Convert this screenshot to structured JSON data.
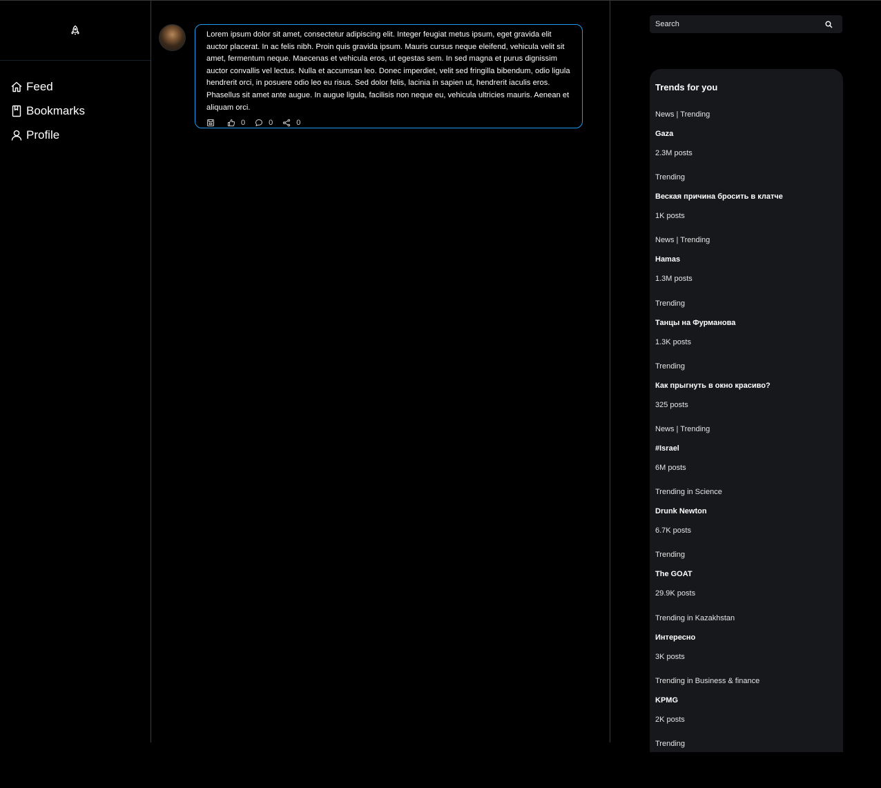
{
  "sidebar": {
    "items": [
      {
        "label": "Feed",
        "icon": "home-icon"
      },
      {
        "label": "Bookmarks",
        "icon": "bookmark-icon"
      },
      {
        "label": "Profile",
        "icon": "user-icon"
      }
    ]
  },
  "post": {
    "text": "Lorem ipsum dolor sit amet, consectetur adipiscing elit. Integer feugiat metus ipsum, eget gravida elit auctor placerat. In ac felis nibh. Proin quis gravida ipsum. Mauris cursus neque eleifend, vehicula velit sit amet, fermentum neque. Maecenas et vehicula eros, ut egestas sem. In sed magna et purus dignissim auctor convallis vel lectus. Nulla et accumsan leo. Donec imperdiet, velit sed fringilla bibendum, odio ligula hendrerit orci, in posuere odio leo eu risus. Sed dolor felis, lacinia in sapien ut, hendrerit iaculis eros. Phasellus sit amet ante augue. In augue ligula, facilisis non neque eu, vehicula ultricies mauris. Aenean et aliquam orci.",
    "likes": "0",
    "comments": "0",
    "shares": "0"
  },
  "search": {
    "placeholder": "Search"
  },
  "trends": {
    "title": "Trends for you",
    "items": [
      {
        "category": "News | Trending",
        "name": "Gaza",
        "posts": "2.3M posts"
      },
      {
        "category": "Trending",
        "name": "Веская причина бросить в клатче",
        "posts": "1K posts"
      },
      {
        "category": "News | Trending",
        "name": "Hamas",
        "posts": "1.3M posts"
      },
      {
        "category": "Trending",
        "name": "Танцы на Фурманова",
        "posts": "1.3K posts"
      },
      {
        "category": "Trending",
        "name": "Как прыгнуть в окно красиво?",
        "posts": "325 posts"
      },
      {
        "category": "News | Trending",
        "name": "#Israel",
        "posts": "6M posts"
      },
      {
        "category": "Trending in Science",
        "name": "Drunk Newton",
        "posts": "6.7K posts"
      },
      {
        "category": "Trending",
        "name": "The GOAT",
        "posts": "29.9K posts"
      },
      {
        "category": "Trending in Kazakhstan",
        "name": "Интересно",
        "posts": "3K posts"
      },
      {
        "category": "Trending in Business & finance",
        "name": "KPMG",
        "posts": "2K posts"
      },
      {
        "category": "Trending",
        "name": "",
        "posts": ""
      }
    ]
  },
  "colors": {
    "accent": "#1d9bf0",
    "panel": "#16181c",
    "background": "#000000"
  }
}
